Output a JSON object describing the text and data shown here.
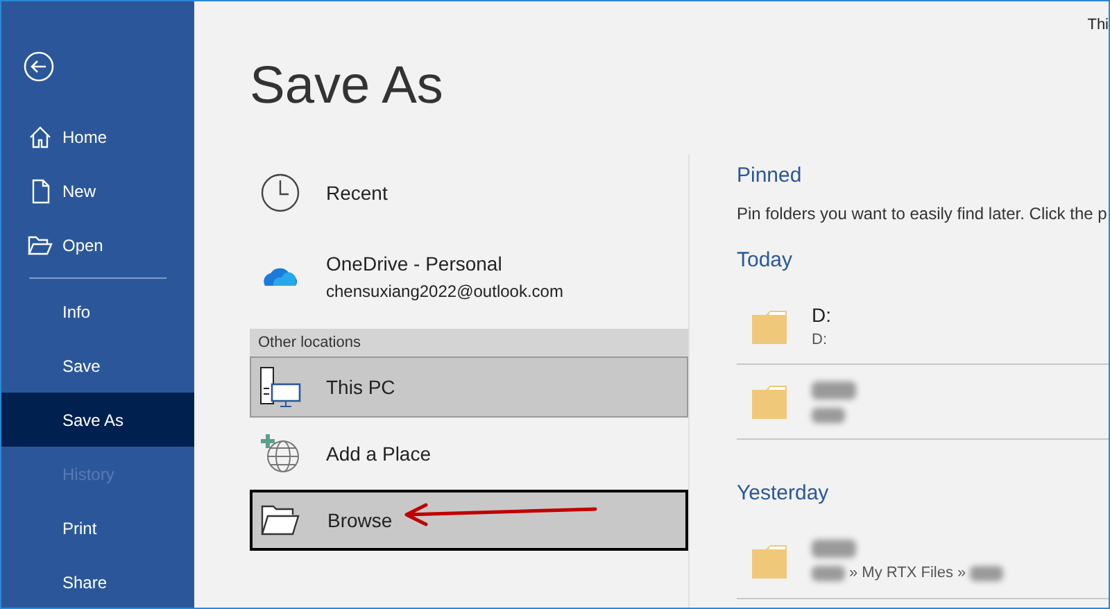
{
  "top_right_text": "Thi",
  "sidebar": {
    "items": [
      {
        "label": "Home",
        "kind": "home",
        "selected": false,
        "disabled": false,
        "divider_before": false
      },
      {
        "label": "New",
        "kind": "new",
        "selected": false,
        "disabled": false,
        "divider_before": false
      },
      {
        "label": "Open",
        "kind": "open",
        "selected": false,
        "disabled": false,
        "divider_before": false
      },
      {
        "label": "Info",
        "kind": "plain",
        "selected": false,
        "disabled": false,
        "divider_before": true
      },
      {
        "label": "Save",
        "kind": "plain",
        "selected": false,
        "disabled": false,
        "divider_before": false
      },
      {
        "label": "Save As",
        "kind": "plain",
        "selected": true,
        "disabled": false,
        "divider_before": false
      },
      {
        "label": "History",
        "kind": "plain",
        "selected": false,
        "disabled": true,
        "divider_before": false
      },
      {
        "label": "Print",
        "kind": "plain",
        "selected": false,
        "disabled": false,
        "divider_before": false
      },
      {
        "label": "Share",
        "kind": "plain",
        "selected": false,
        "disabled": false,
        "divider_before": false
      }
    ]
  },
  "title": "Save As",
  "locations": [
    {
      "kind": "recent",
      "label": "Recent",
      "selected": false,
      "outlined": false
    },
    {
      "kind": "onedrive",
      "label": "OneDrive - Personal",
      "sublabel": "chensuxiang2022@outlook.com",
      "selected": false,
      "outlined": false
    },
    {
      "kind": "header",
      "label": "Other locations"
    },
    {
      "kind": "pc",
      "label": "This PC",
      "selected": true,
      "outlined": false
    },
    {
      "kind": "place",
      "label": "Add a Place",
      "selected": false,
      "outlined": false
    },
    {
      "kind": "browse",
      "label": "Browse",
      "selected": true,
      "outlined": true
    }
  ],
  "pinned": {
    "heading": "Pinned",
    "hint": "Pin folders you want to easily find later. Click the p"
  },
  "groups": [
    {
      "heading": "Today",
      "folders": [
        {
          "name": {
            "kind": "text",
            "text": "D:"
          },
          "path": [
            {
              "kind": "text",
              "text": "D:"
            }
          ]
        },
        {
          "name": {
            "kind": "blurred"
          },
          "path": [
            {
              "kind": "blurred"
            }
          ]
        }
      ]
    },
    {
      "heading": "Yesterday",
      "folders": [
        {
          "name": {
            "kind": "blurred"
          },
          "path": [
            {
              "kind": "blurred"
            },
            {
              "kind": "text",
              "text": "» My RTX Files »"
            },
            {
              "kind": "blurred"
            }
          ]
        }
      ]
    }
  ]
}
